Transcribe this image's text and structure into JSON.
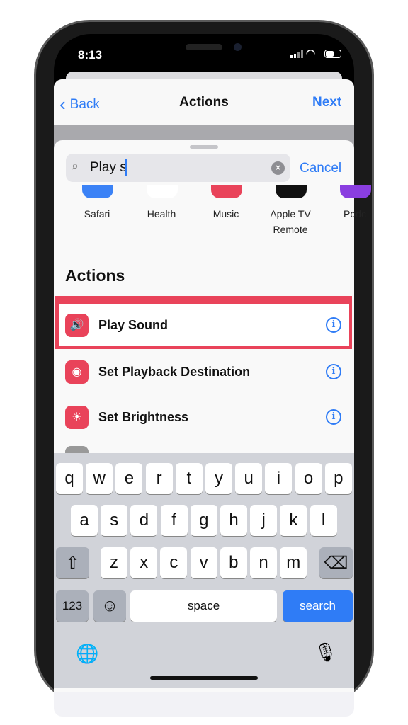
{
  "status": {
    "time": "8:13"
  },
  "nav": {
    "back": "Back",
    "title": "Actions",
    "next": "Next"
  },
  "search": {
    "value": "Play s",
    "cancel": "Cancel"
  },
  "apps": [
    {
      "label": "Safari",
      "color": "#3b82f6"
    },
    {
      "label": "Health",
      "color": "#ffffff"
    },
    {
      "label": "Music",
      "color": "#e9435a"
    },
    {
      "label": "Apple TV Remote",
      "color": "#111111"
    },
    {
      "label": "Podc",
      "color": "#8a3ee0"
    }
  ],
  "section": "Actions",
  "actions": [
    {
      "label": "Play Sound",
      "icon": "speaker-icon",
      "glyph": "🔊",
      "highlighted": true
    },
    {
      "label": "Set Playback Destination",
      "icon": "airplay-audio-icon",
      "glyph": "◉"
    },
    {
      "label": "Set Brightness",
      "icon": "sun-icon",
      "glyph": "☀"
    }
  ],
  "keyboard": {
    "row1": [
      "q",
      "w",
      "e",
      "r",
      "t",
      "y",
      "u",
      "i",
      "o",
      "p"
    ],
    "row2": [
      "a",
      "s",
      "d",
      "f",
      "g",
      "h",
      "j",
      "k",
      "l"
    ],
    "row3": [
      "z",
      "x",
      "c",
      "v",
      "b",
      "n",
      "m"
    ],
    "shift": "⇧",
    "delete": "⌫",
    "numbers": "123",
    "emoji": "☺",
    "space": "space",
    "search": "search",
    "globe": "🌐",
    "mic": "🎙"
  },
  "colors": {
    "accent": "#2f7cf6",
    "highlight": "#e9435a"
  }
}
